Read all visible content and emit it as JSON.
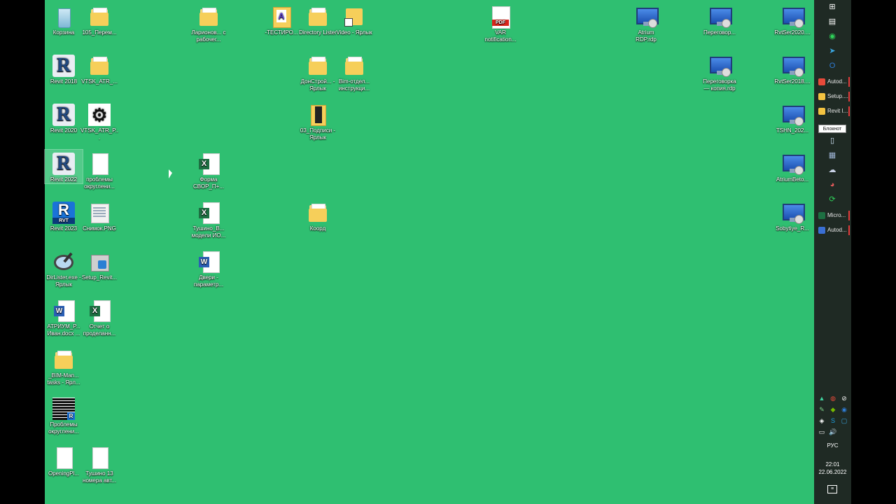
{
  "desktop": {
    "icons": [
      {
        "label": "Корзина",
        "type": "recycle"
      },
      {
        "label": "105_Перем...",
        "type": "folder"
      },
      {
        "label": "Ларионов... с рабочег...",
        "type": "folder"
      },
      {
        "label": "-ТЕСТИРО...",
        "type": "tester"
      },
      {
        "label": "Directory Lister",
        "type": "folder"
      },
      {
        "label": "Video - Ярлык",
        "type": "video"
      },
      {
        "label": "VAR notification...",
        "type": "pdf"
      },
      {
        "label": "Atrium RDP.rdp",
        "type": "rdp"
      },
      {
        "label": "Переговор...",
        "type": "rdp"
      },
      {
        "label": "RvtSer2020....",
        "type": "rdp"
      },
      {
        "label": "Revit 2018",
        "type": "revit"
      },
      {
        "label": "VTSK_ATR_...",
        "type": "folder"
      },
      {
        "label": "ДонСтрой... - Ярлык",
        "type": "folder"
      },
      {
        "label": "Bim-отдел... инструкци...",
        "type": "folder"
      },
      {
        "label": "Переговорка — копия.rdp",
        "type": "rdp"
      },
      {
        "label": "RvtSer2018....",
        "type": "rdp"
      },
      {
        "label": "Revit 2020",
        "type": "revit"
      },
      {
        "label": "VTSK_ATR_P...",
        "type": "atr"
      },
      {
        "label": "03_Подписи - Ярлык",
        "type": "door"
      },
      {
        "label": "TSHN_202...",
        "type": "rdp"
      },
      {
        "label": "Revit 2022",
        "type": "revit"
      },
      {
        "label": "проблемы округлени...",
        "type": "file"
      },
      {
        "label": "Форма СВОР_П+...",
        "type": "excel"
      },
      {
        "label": "AtriumBeto...",
        "type": "rdp"
      },
      {
        "label": "Revit 2023",
        "type": "revit23"
      },
      {
        "label": "Снимок.PNG",
        "type": "png"
      },
      {
        "label": "Тушино_В... модели ИО...",
        "type": "excel"
      },
      {
        "label": "Коорд",
        "type": "folder"
      },
      {
        "label": "Sobytiye_R...",
        "type": "rdp"
      },
      {
        "label": "DirLister.exe - Ярлык",
        "type": "mag"
      },
      {
        "label": "Setup_Revit...",
        "type": "setup"
      },
      {
        "label": "Двери - параметр...",
        "type": "word"
      },
      {
        "label": "АТРИУМ_Р... Иван.docx ...",
        "type": "word"
      },
      {
        "label": "Отчет о проделанн...",
        "type": "excel"
      },
      {
        "label": "_BIM-Man... tasks - Ярл...",
        "type": "folder"
      },
      {
        "label": "Проблемы округлени...",
        "type": "grid"
      },
      {
        "label": "OpeningPl...",
        "type": "file"
      },
      {
        "label": "Тушино 13 номера авт...",
        "type": "file"
      }
    ]
  },
  "taskbar": {
    "top_icons": [
      {
        "name": "windows-start-icon",
        "glyph": "⊞",
        "color": "#ffffff"
      },
      {
        "name": "task-view-icon",
        "glyph": "▤",
        "color": "#ffffff"
      },
      {
        "name": "whatsapp-icon",
        "glyph": "◉",
        "color": "#2fd35a"
      },
      {
        "name": "telegram-icon",
        "glyph": "➤",
        "color": "#3aa6e0"
      },
      {
        "name": "outlook-icon",
        "glyph": "O",
        "color": "#2e7cd6"
      }
    ],
    "apps": [
      {
        "label": "Autod...",
        "color": "#e84a3a",
        "active": true
      },
      {
        "label": "Setup....",
        "color": "#f3c341",
        "active": true
      },
      {
        "label": "Revit I...",
        "color": "#f3c341",
        "active": true
      }
    ],
    "tooltip": "Блокнот",
    "mid_icons": [
      {
        "name": "notepad-icon",
        "glyph": "▯",
        "color": "#cfe4f7"
      },
      {
        "name": "calculator-icon",
        "glyph": "▦",
        "color": "#9fb5d6"
      },
      {
        "name": "remote-desktop-icon",
        "glyph": "☁",
        "color": "#c9d2e6"
      },
      {
        "name": "paint-icon",
        "glyph": "◕",
        "color": "#e25a5a"
      },
      {
        "name": "sync-icon",
        "glyph": "⟳",
        "color": "#2fd35a"
      }
    ],
    "apps2": [
      {
        "label": "Micro...",
        "color": "#1d6f42",
        "active": true
      },
      {
        "label": "Autod...",
        "color": "#3a6fd4",
        "active": true
      }
    ],
    "tray": [
      {
        "name": "autodesk-tray-icon",
        "glyph": "▲",
        "color": "#3fd4a0"
      },
      {
        "name": "chrome-tray-icon",
        "glyph": "◍",
        "color": "#e84a3a"
      },
      {
        "name": "link-tray-icon",
        "glyph": "⊘",
        "color": "#ffffff"
      },
      {
        "name": "pen-tray-icon",
        "glyph": "✎",
        "color": "#7fd48a"
      },
      {
        "name": "nvidia-tray-icon",
        "glyph": "◆",
        "color": "#76b900"
      },
      {
        "name": "eye-tray-icon",
        "glyph": "◉",
        "color": "#2e7cd6"
      },
      {
        "name": "dropbox-tray-icon",
        "glyph": "◈",
        "color": "#ffffff"
      },
      {
        "name": "skype-tray-icon",
        "glyph": "S",
        "color": "#1fa0e0"
      },
      {
        "name": "screen-tray-icon",
        "glyph": "▢",
        "color": "#3aa6e0"
      },
      {
        "name": "network-tray-icon",
        "glyph": "▭",
        "color": "#ffffff"
      },
      {
        "name": "volume-tray-icon",
        "glyph": "🔊",
        "color": "#ffffff"
      }
    ],
    "lang": "РУС",
    "time": "22:01",
    "date": "22.06.2022",
    "notification_glyph": "≡"
  }
}
